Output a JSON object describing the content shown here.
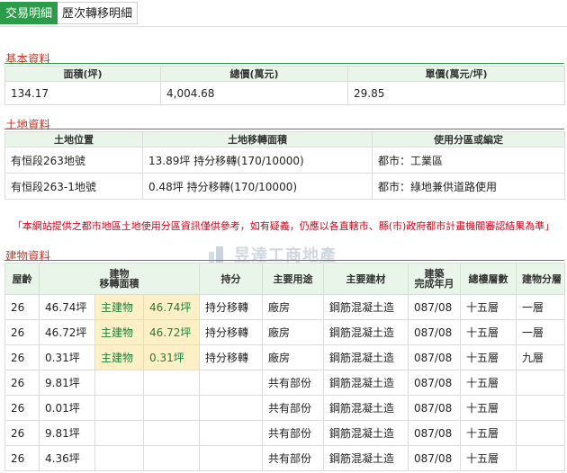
{
  "tabs": [
    {
      "label": "交易明細",
      "active": true
    },
    {
      "label": "歷次轉移明細",
      "active": false
    }
  ],
  "basic": {
    "title": "基本資料",
    "headers": [
      "面積(坪)",
      "總價(萬元)",
      "單價(萬元/坪)"
    ],
    "values": [
      "134.17",
      "4,004.68",
      "29.85"
    ]
  },
  "land": {
    "title": "土地資料",
    "headers": [
      "土地位置",
      "土地移轉面積",
      "使用分區或編定"
    ],
    "rows": [
      [
        "有恒段263地號",
        "13.89坪 持分移轉(170/10000)",
        "都市：工業區"
      ],
      [
        "有恒段263-1地號",
        "0.48坪 持分移轉(170/10000)",
        "都市：綠地兼供道路使用"
      ]
    ]
  },
  "notice": "「本網站提供之都市地區土地使用分區資訊僅供參考，如有疑義，仍應以各直轄市、縣(市)政府都市計畫機關審認結果為準」",
  "building": {
    "title": "建物資料",
    "headers": [
      "屋齡",
      "建物\n移轉面積",
      "持分",
      "主要用途",
      "主要建材",
      "建築\n完成年月",
      "總樓層數",
      "建物分層"
    ],
    "rows": [
      [
        "26",
        "46.74坪",
        "主建物",
        "46.74坪",
        "持分移轉",
        "廠房",
        "鋼筋混凝土造",
        "087/08",
        "十五層",
        "一層"
      ],
      [
        "26",
        "46.72坪",
        "主建物",
        "46.72坪",
        "持分移轉",
        "廠房",
        "鋼筋混凝土造",
        "087/08",
        "十五層",
        "一層"
      ],
      [
        "26",
        "0.31坪",
        "主建物",
        "0.31坪",
        "持分移轉",
        "廠房",
        "鋼筋混凝土造",
        "087/08",
        "十五層",
        "九層"
      ],
      [
        "26",
        "9.81坪",
        "",
        "",
        "",
        "共有部份",
        "鋼筋混凝土造",
        "087/08",
        "十五層",
        ""
      ],
      [
        "26",
        "0.01坪",
        "",
        "",
        "",
        "共有部份",
        "鋼筋混凝土造",
        "087/08",
        "十五層",
        ""
      ],
      [
        "26",
        "9.81坪",
        "",
        "",
        "",
        "共有部份",
        "鋼筋混凝土造",
        "087/08",
        "十五層",
        ""
      ],
      [
        "26",
        "4.36坪",
        "",
        "",
        "",
        "共有部份",
        "鋼筋混凝土造",
        "087/08",
        "十五層",
        ""
      ]
    ]
  },
  "watermark": {
    "text": "昱達工商地產",
    "sub": "Real estate consult"
  },
  "colors": {
    "accent": "#2c9b4a",
    "title": "#c0392b",
    "header_bg": "#e9f5e9",
    "highlight": "#fdf0c6",
    "notice": "#d0021b"
  }
}
